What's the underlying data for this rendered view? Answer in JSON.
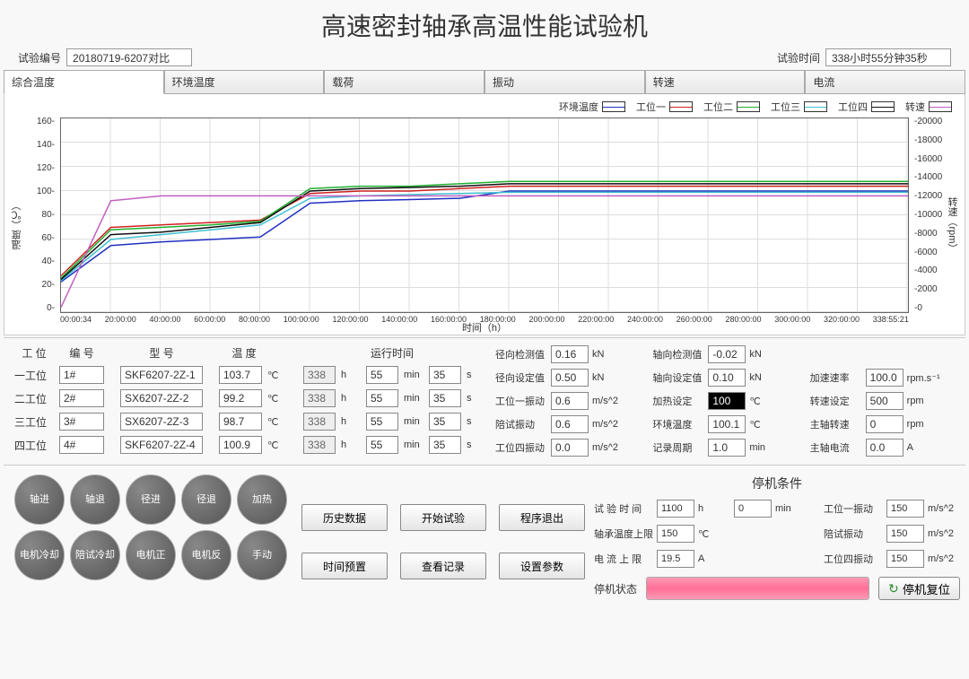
{
  "title": "高速密封轴承高温性能试验机",
  "header": {
    "test_no_label": "试验编号",
    "test_no": "20180719-6207对比",
    "test_time_label": "试验时间",
    "test_time": "338小时55分钟35秒"
  },
  "tabs": [
    "综合温度",
    "环境温度",
    "载荷",
    "振动",
    "转速",
    "电流"
  ],
  "legend": [
    {
      "label": "环境温度",
      "color": "#2030c0"
    },
    {
      "label": "工位一",
      "color": "#d02020"
    },
    {
      "label": "工位二",
      "color": "#20b030"
    },
    {
      "label": "工位三",
      "color": "#40c0d0"
    },
    {
      "label": "工位四",
      "color": "#101010"
    },
    {
      "label": "转速",
      "color": "#c060c0"
    }
  ],
  "chart_data": {
    "type": "line",
    "title": "综合温度",
    "xlabel": "时间（h）",
    "ylabel_left": "温度（℃）",
    "ylabel_right": "转速（rpm）",
    "ylim_left": [
      0,
      160
    ],
    "y_ticks_left": [
      0,
      20,
      40,
      60,
      80,
      100,
      120,
      140,
      160
    ],
    "ylim_right": [
      0,
      20000
    ],
    "y_ticks_right": [
      0,
      2000,
      4000,
      6000,
      8000,
      10000,
      12000,
      14000,
      16000,
      18000,
      20000
    ],
    "x_ticks": [
      "00:00:34",
      "20:00:00",
      "40:00:00",
      "60:00:00",
      "80:00:00",
      "100:00:00",
      "120:00:00",
      "140:00:00",
      "160:00:00",
      "180:00:00",
      "200:00:00",
      "220:00:00",
      "240:00:00",
      "260:00:00",
      "280:00:00",
      "300:00:00",
      "320:00:00",
      "338:55:21"
    ],
    "series": [
      {
        "name": "环境温度",
        "axis": "left",
        "color": "#2030c0",
        "values": [
          25,
          55,
          58,
          60,
          62,
          90,
          92,
          93,
          94,
          100,
          100,
          100,
          100,
          100,
          100,
          100,
          100,
          100
        ]
      },
      {
        "name": "工位一",
        "axis": "left",
        "color": "#d02020",
        "values": [
          30,
          70,
          72,
          74,
          76,
          98,
          100,
          100,
          102,
          104,
          104,
          104,
          104,
          104,
          104,
          104,
          104,
          104
        ]
      },
      {
        "name": "工位二",
        "axis": "left",
        "color": "#20b030",
        "values": [
          28,
          68,
          70,
          72,
          75,
          102,
          104,
          104,
          106,
          108,
          108,
          108,
          108,
          108,
          108,
          108,
          108,
          108
        ]
      },
      {
        "name": "工位三",
        "axis": "left",
        "color": "#40c0d0",
        "values": [
          26,
          60,
          64,
          68,
          72,
          94,
          96,
          97,
          98,
          99,
          99,
          99,
          99,
          99,
          99,
          99,
          99,
          99
        ]
      },
      {
        "name": "工位四",
        "axis": "left",
        "color": "#101010",
        "values": [
          27,
          64,
          66,
          70,
          74,
          100,
          102,
          103,
          104,
          106,
          106,
          106,
          106,
          106,
          106,
          106,
          106,
          106
        ]
      },
      {
        "name": "转速",
        "axis": "right",
        "color": "#c060c0",
        "values": [
          500,
          11500,
          12000,
          12000,
          12000,
          12000,
          12000,
          12000,
          12000,
          12000,
          12000,
          12000,
          12000,
          12000,
          12000,
          12000,
          12000,
          12000
        ]
      }
    ]
  },
  "stations_header": {
    "pos": "工  位",
    "num": "编  号",
    "model": "型  号",
    "temp": "温  度",
    "runtime": "运行时间"
  },
  "runtime_units": {
    "h": "h",
    "min": "min",
    "s": "s"
  },
  "stations": [
    {
      "pos": "一工位",
      "num": "1#",
      "model": "SKF6207-2Z-1",
      "temp": "103.7",
      "unit": "℃",
      "h": "338",
      "m": "55",
      "s": "35"
    },
    {
      "pos": "二工位",
      "num": "2#",
      "model": "SX6207-2Z-2",
      "temp": "99.2",
      "unit": "℃",
      "h": "338",
      "m": "55",
      "s": "35"
    },
    {
      "pos": "三工位",
      "num": "3#",
      "model": "SX6207-2Z-3",
      "temp": "98.7",
      "unit": "℃",
      "h": "338",
      "m": "55",
      "s": "35"
    },
    {
      "pos": "四工位",
      "num": "4#",
      "model": "SKF6207-2Z-4",
      "temp": "100.9",
      "unit": "℃",
      "h": "338",
      "m": "55",
      "s": "35"
    }
  ],
  "meas": {
    "radial_detect": {
      "label": "径向检测值",
      "val": "0.16",
      "unit": "kN"
    },
    "axial_detect": {
      "label": "轴向检测值",
      "val": "-0.02",
      "unit": "kN"
    },
    "radial_set": {
      "label": "径向设定值",
      "val": "0.50",
      "unit": "kN"
    },
    "axial_set": {
      "label": "轴向设定值",
      "val": "0.10",
      "unit": "kN"
    },
    "accel_rate": {
      "label": "加速速率",
      "val": "100.0",
      "unit": "rpm.s⁻¹"
    },
    "pos1_vib": {
      "label": "工位一振动",
      "val": "0.6",
      "unit": "m/s^2"
    },
    "heat_set": {
      "label": "加热设定",
      "val": "100",
      "unit": "℃",
      "hl": true
    },
    "speed_set": {
      "label": "转速设定",
      "val": "500",
      "unit": "rpm"
    },
    "comp_vib": {
      "label": "陪试振动",
      "val": "0.6",
      "unit": "m/s^2"
    },
    "env_temp": {
      "label": "环境温度",
      "val": "100.1",
      "unit": "℃"
    },
    "main_speed": {
      "label": "主轴转速",
      "val": "0",
      "unit": "rpm"
    },
    "pos4_vib": {
      "label": "工位四振动",
      "val": "0.0",
      "unit": "m/s^2"
    },
    "rec_period": {
      "label": "记录周期",
      "val": "1.0",
      "unit": "min"
    },
    "main_current": {
      "label": "主轴电流",
      "val": "0.0",
      "unit": "A"
    }
  },
  "round_buttons": [
    "轴进",
    "轴退",
    "径进",
    "径退",
    "加热",
    "电机冷却",
    "陪试冷却",
    "电机正",
    "电机反",
    "手动"
  ],
  "center_buttons": [
    "历史数据",
    "开始试验",
    "程序退出",
    "时间预置",
    "查看记录",
    "设置参数"
  ],
  "stop": {
    "title": "停机条件",
    "rows_left": [
      {
        "label": "试  验  时  间",
        "v1": "1100",
        "u1": "h",
        "v2": "0",
        "u2": "min"
      },
      {
        "label": "轴承温度上限",
        "v1": "150",
        "u1": "℃"
      },
      {
        "label": "电  流  上  限",
        "v1": "19.5",
        "u1": "A"
      }
    ],
    "rows_right": [
      {
        "label": "工位一振动",
        "v1": "150",
        "u1": "m/s^2"
      },
      {
        "label": "陪试振动",
        "v1": "150",
        "u1": "m/s^2"
      },
      {
        "label": "工位四振动",
        "v1": "150",
        "u1": "m/s^2"
      }
    ],
    "status_label": "停机状态",
    "reset": "停机复位"
  }
}
